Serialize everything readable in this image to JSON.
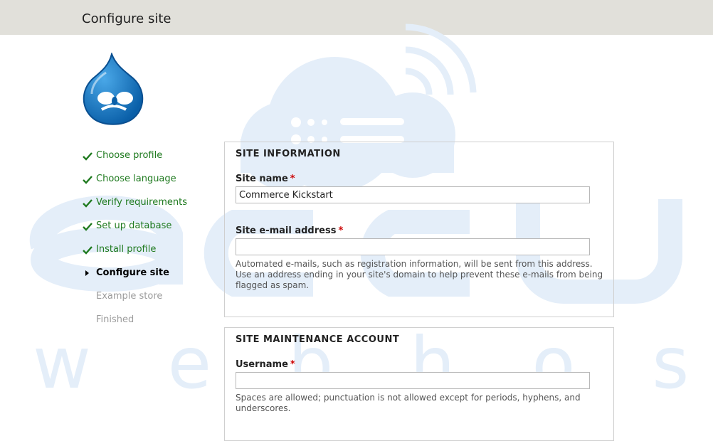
{
  "header": {
    "title": "Configure site"
  },
  "steps": [
    {
      "label": "Choose profile",
      "state": "done"
    },
    {
      "label": "Choose language",
      "state": "done"
    },
    {
      "label": "Verify requirements",
      "state": "done"
    },
    {
      "label": "Set up database",
      "state": "done"
    },
    {
      "label": "Install profile",
      "state": "done"
    },
    {
      "label": "Configure site",
      "state": "active"
    },
    {
      "label": "Example store",
      "state": "pending"
    },
    {
      "label": "Finished",
      "state": "pending"
    }
  ],
  "site_info": {
    "legend": "SITE INFORMATION",
    "site_name_label": "Site name",
    "site_name_value": "Commerce Kickstart",
    "email_label": "Site e-mail address",
    "email_value": "",
    "email_desc": "Automated e-mails, such as registration information, will be sent from this address. Use an address ending in your site's domain to help prevent these e-mails from being flagged as spam."
  },
  "maintenance": {
    "legend": "SITE MAINTENANCE ACCOUNT",
    "username_label": "Username",
    "username_value": "",
    "username_desc": "Spaces are allowed; punctuation is not allowed except for periods, hyphens, and underscores."
  },
  "required_marker": "*",
  "colors": {
    "header_bg": "#e1e0da",
    "done": "#1f7a1f",
    "required": "#cc0000",
    "watermark": "#e4eef9"
  },
  "watermark": {
    "line1": "accu",
    "line2": "w e b h o s t i n g"
  }
}
